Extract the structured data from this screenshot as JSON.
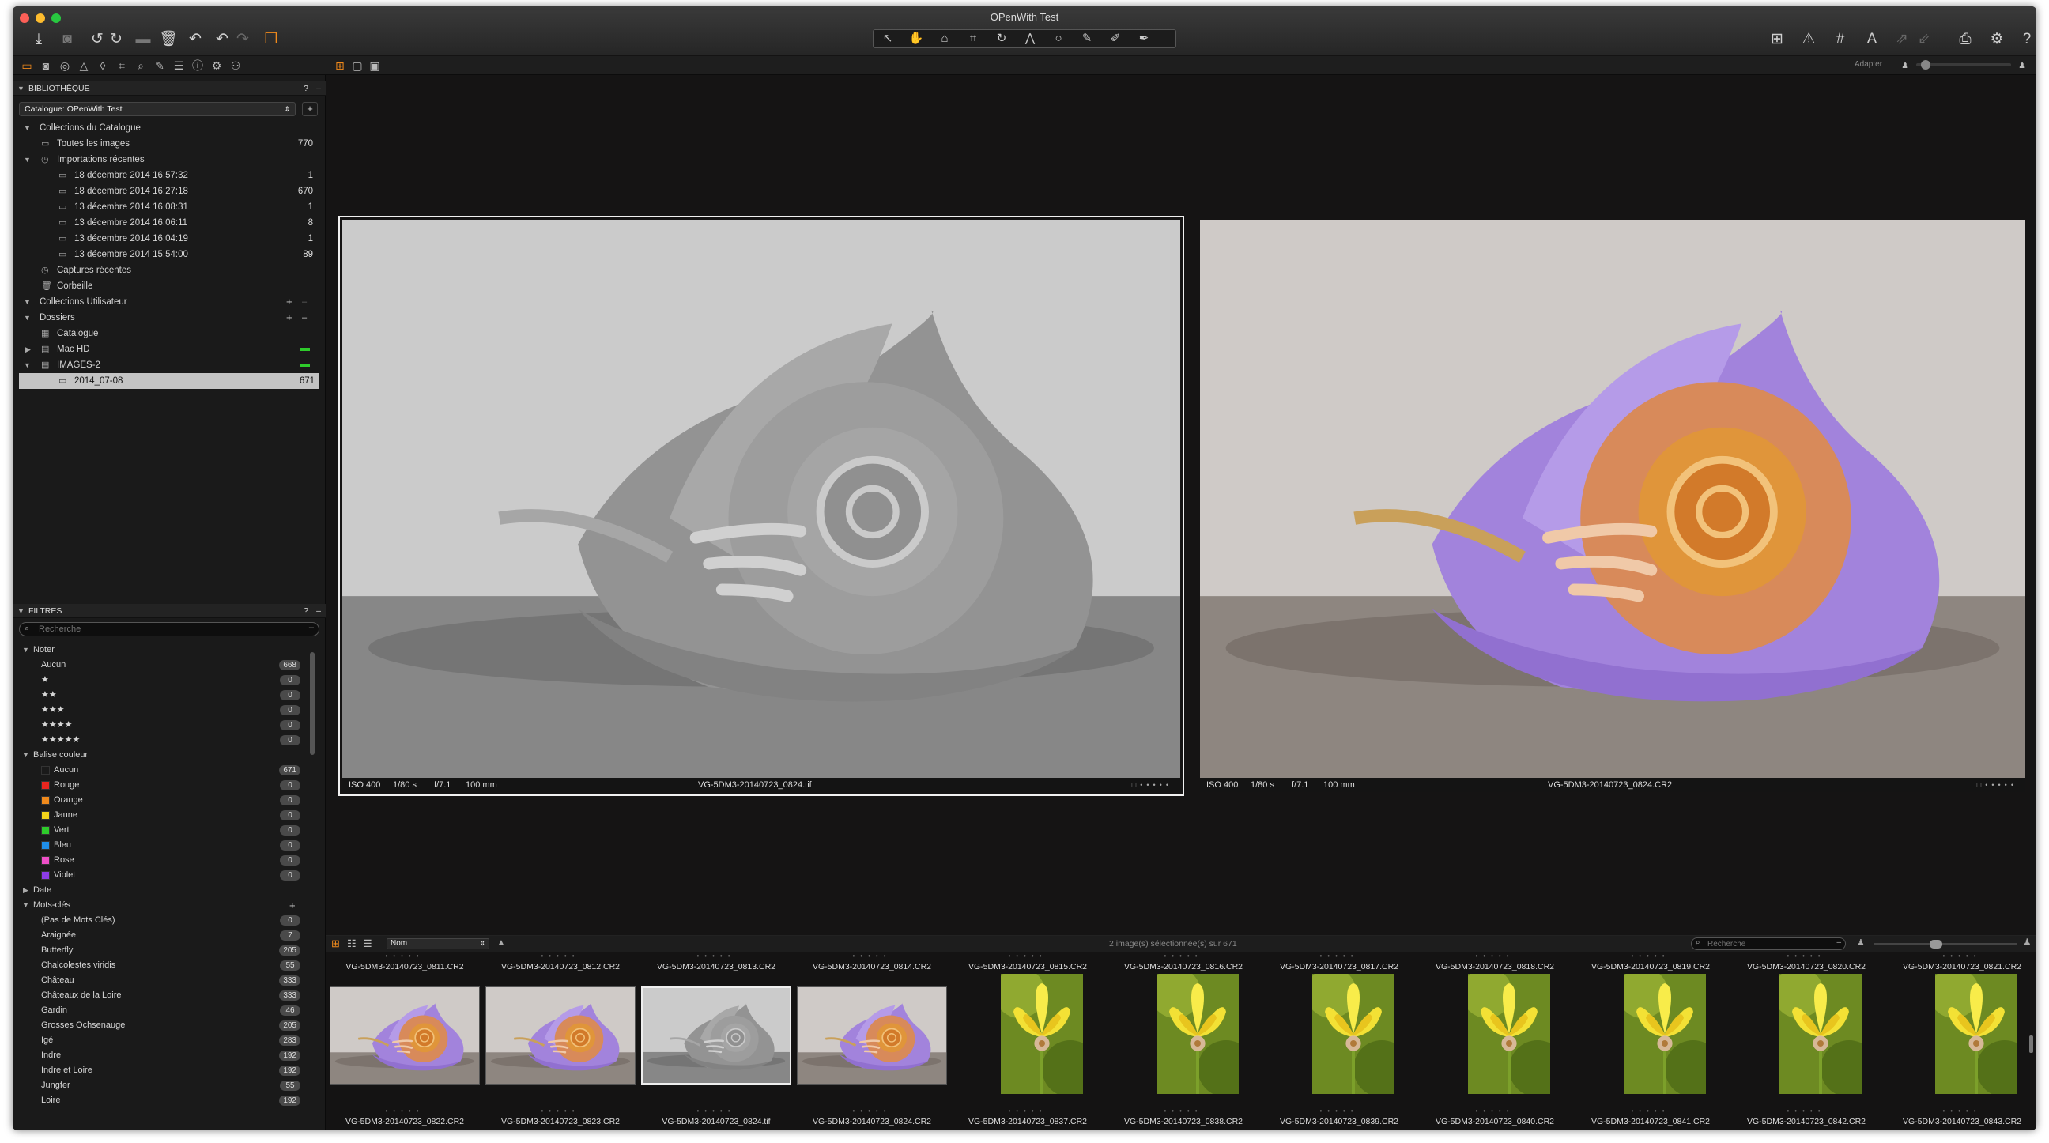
{
  "window": {
    "title": "OPenWith Test"
  },
  "viewer_toolbar": {
    "adapter_label": "Adapter"
  },
  "library": {
    "title": "BIBLIOTHÈQUE",
    "help": "?",
    "catalogue_select": "Catalogue: OPenWith Test",
    "collections_title": "Collections du Catalogue",
    "all_images": {
      "label": "Toutes les images",
      "count": "770"
    },
    "recent_imports": {
      "label": "Importations récentes",
      "items": [
        {
          "label": "18 décembre 2014 16:57:32",
          "count": "1"
        },
        {
          "label": "18 décembre 2014 16:27:18",
          "count": "670"
        },
        {
          "label": "13 décembre 2014 16:08:31",
          "count": "1"
        },
        {
          "label": "13 décembre 2014 16:06:11",
          "count": "8"
        },
        {
          "label": "13 décembre 2014 16:04:19",
          "count": "1"
        },
        {
          "label": "13 décembre 2014 15:54:00",
          "count": "89"
        }
      ]
    },
    "recent_captures": "Captures récentes",
    "trash": "Corbeille",
    "user_collections": "Collections Utilisateur",
    "folders": {
      "label": "Dossiers",
      "items": [
        {
          "label": "Catalogue"
        },
        {
          "label": "Mac HD"
        },
        {
          "label": "IMAGES-2"
        }
      ],
      "selected": {
        "label": "2014_07-08",
        "count": "671"
      }
    }
  },
  "filters": {
    "title": "FILTRES",
    "help": "?",
    "search_placeholder": "Recherche",
    "rating": {
      "label": "Noter",
      "items": [
        {
          "label": "Aucun",
          "count": "668"
        },
        {
          "label": "★",
          "count": "0"
        },
        {
          "label": "★★",
          "count": "0"
        },
        {
          "label": "★★★",
          "count": "0"
        },
        {
          "label": "★★★★",
          "count": "0"
        },
        {
          "label": "★★★★★",
          "count": "0"
        }
      ]
    },
    "color_tag": {
      "label": "Balise couleur",
      "items": [
        {
          "label": "Aucun",
          "count": "671",
          "color": "#1a1a1a"
        },
        {
          "label": "Rouge",
          "count": "0",
          "color": "#e8261f"
        },
        {
          "label": "Orange",
          "count": "0",
          "color": "#f08a1c"
        },
        {
          "label": "Jaune",
          "count": "0",
          "color": "#f2d31b"
        },
        {
          "label": "Vert",
          "count": "0",
          "color": "#2ecb2b"
        },
        {
          "label": "Bleu",
          "count": "0",
          "color": "#1f8ee8"
        },
        {
          "label": "Rose",
          "count": "0",
          "color": "#ee4fc7"
        },
        {
          "label": "Violet",
          "count": "0",
          "color": "#8d3de6"
        }
      ]
    },
    "date": "Date",
    "keywords": {
      "label": "Mots-clés",
      "items": [
        {
          "label": "(Pas de Mots Clés)",
          "count": "0"
        },
        {
          "label": "Araignée",
          "count": "7"
        },
        {
          "label": "Butterfly",
          "count": "205"
        },
        {
          "label": "Chalcolestes viridis",
          "count": "55"
        },
        {
          "label": "Château",
          "count": "333"
        },
        {
          "label": "Châteaux de la Loire",
          "count": "333"
        },
        {
          "label": "Gardin",
          "count": "46"
        },
        {
          "label": "Grosses Ochsenauge",
          "count": "205"
        },
        {
          "label": "Igé",
          "count": "283"
        },
        {
          "label": "Indre",
          "count": "192"
        },
        {
          "label": "Indre et Loire",
          "count": "192"
        },
        {
          "label": "Jungfer",
          "count": "55"
        },
        {
          "label": "Loire",
          "count": "192"
        }
      ]
    }
  },
  "viewer": {
    "left": {
      "iso": "ISO 400",
      "shutter": "1/80 s",
      "aperture": "f/7.1",
      "focal": "100 mm",
      "filename": "VG-5DM3-20140723_0824.tif"
    },
    "right": {
      "iso": "ISO 400",
      "shutter": "1/80 s",
      "aperture": "f/7.1",
      "focal": "100 mm",
      "filename": "VG-5DM3-20140723_0824.CR2"
    }
  },
  "browser": {
    "sort_label": "Nom",
    "selection_status": "2 image(s) sélectionnée(s) sur 671",
    "search_placeholder": "Recherche",
    "row1_names": [
      "VG-5DM3-20140723_0811.CR2",
      "VG-5DM3-20140723_0812.CR2",
      "VG-5DM3-20140723_0813.CR2",
      "VG-5DM3-20140723_0814.CR2",
      "VG-5DM3-20140723_0815.CR2",
      "VG-5DM3-20140723_0816.CR2",
      "VG-5DM3-20140723_0817.CR2",
      "VG-5DM3-20140723_0818.CR2",
      "VG-5DM3-20140723_0819.CR2",
      "VG-5DM3-20140723_0820.CR2",
      "VG-5DM3-20140723_0821.CR2"
    ],
    "row2": [
      {
        "name": "VG-5DM3-20140723_0822.CR2",
        "kind": "snail"
      },
      {
        "name": "VG-5DM3-20140723_0823.CR2",
        "kind": "snail"
      },
      {
        "name": "VG-5DM3-20140723_0824.tif",
        "kind": "snail-gray"
      },
      {
        "name": "VG-5DM3-20140723_0824.CR2",
        "kind": "snail"
      },
      {
        "name": "VG-5DM3-20140723_0837.CR2",
        "kind": "flower"
      },
      {
        "name": "VG-5DM3-20140723_0838.CR2",
        "kind": "flower"
      },
      {
        "name": "VG-5DM3-20140723_0839.CR2",
        "kind": "flower"
      },
      {
        "name": "VG-5DM3-20140723_0840.CR2",
        "kind": "flower"
      },
      {
        "name": "VG-5DM3-20140723_0841.CR2",
        "kind": "flower"
      },
      {
        "name": "VG-5DM3-20140723_0842.CR2",
        "kind": "flower"
      },
      {
        "name": "VG-5DM3-20140723_0843.CR2",
        "kind": "flower"
      }
    ]
  }
}
